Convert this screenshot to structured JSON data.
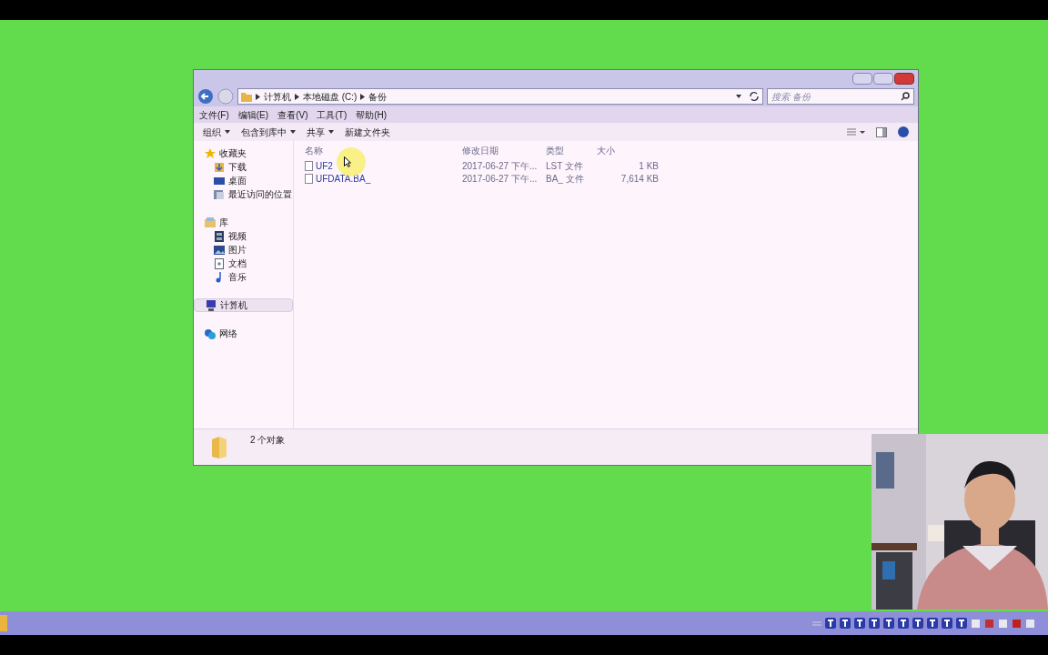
{
  "window": {
    "breadcrumb": [
      "计算机",
      "本地磁盘 (C:)",
      "备份"
    ],
    "search": {
      "placeholder": "搜索 备份"
    }
  },
  "menu": [
    "文件(F)",
    "编辑(E)",
    "查看(V)",
    "工具(T)",
    "帮助(H)"
  ],
  "toolbar": [
    {
      "label": "组织",
      "dropdown": true
    },
    {
      "label": "包含到库中",
      "dropdown": true
    },
    {
      "label": "共享",
      "dropdown": true
    },
    {
      "label": "新建文件夹",
      "dropdown": false
    }
  ],
  "sidebar": {
    "items": [
      {
        "label": "收藏夹",
        "kind": "star",
        "selected": false,
        "children": [
          {
            "label": "下载",
            "kind": "download",
            "selected": false
          },
          {
            "label": "桌面",
            "kind": "desktop",
            "selected": false
          },
          {
            "label": "最近访问的位置",
            "kind": "recent",
            "selected": false
          }
        ]
      },
      {
        "label": "库",
        "kind": "library",
        "selected": false,
        "children": [
          {
            "label": "视频",
            "kind": "video",
            "selected": false
          },
          {
            "label": "图片",
            "selected": false
          },
          {
            "label": "文档",
            "kind": "document",
            "selected": false
          },
          {
            "label": "音乐",
            "kind": "music",
            "selected": false
          }
        ]
      },
      {
        "label": "计算机",
        "kind": "computer",
        "selected": true
      },
      {
        "label": "网络",
        "kind": "network",
        "selected": false
      }
    ]
  },
  "table": {
    "columns": [
      "名称",
      "修改日期",
      "类型",
      "大小"
    ],
    "rows": [
      [
        "UF2",
        "2017-06-27 下午...",
        "LST 文件",
        "1 KB"
      ],
      [
        "UFDATA.BA_",
        "2017-06-27 下午...",
        "BA_ 文件",
        "7,614 KB"
      ]
    ]
  },
  "status_bar": "2 个对象"
}
